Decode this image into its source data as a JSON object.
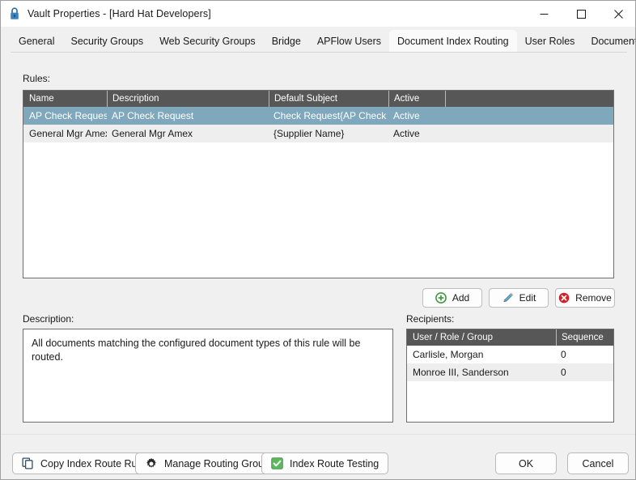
{
  "window": {
    "title": "Vault Properties - [Hard Hat Developers]",
    "lock_icon": "lock-icon",
    "controls": {
      "minimize": "minimize-icon",
      "maximize": "maximize-icon",
      "close": "close-icon"
    }
  },
  "tabs": [
    {
      "label": "General",
      "active": false
    },
    {
      "label": "Security Groups",
      "active": false
    },
    {
      "label": "Web Security Groups",
      "active": false
    },
    {
      "label": "Bridge",
      "active": false
    },
    {
      "label": "APFlow Users",
      "active": false
    },
    {
      "label": "Document Index Routing",
      "active": true
    },
    {
      "label": "User Roles",
      "active": false
    },
    {
      "label": "Document Publishing",
      "active": false
    }
  ],
  "rules": {
    "label": "Rules:",
    "columns": [
      "Name",
      "Description",
      "Default Subject",
      "Active",
      ""
    ],
    "rows": [
      {
        "name": "AP Check Request",
        "description": "AP Check Request",
        "default_subject": "Check Request{AP Check ...",
        "active": "Active",
        "extra": "",
        "selected": true
      },
      {
        "name": "General Mgr Amex",
        "description": "General Mgr Amex",
        "default_subject": "{Supplier Name}",
        "active": "Active",
        "extra": "",
        "selected": false
      }
    ]
  },
  "rule_actions": {
    "add": {
      "label": "Add",
      "icon": "plus-circle-icon",
      "color": "#3f9a3f"
    },
    "edit": {
      "label": "Edit",
      "icon": "pencil-icon",
      "color": "#4a90c4"
    },
    "remove": {
      "label": "Remove",
      "icon": "x-circle-icon",
      "color": "#d32028"
    }
  },
  "description": {
    "label": "Description:",
    "text": "All documents matching the configured document types of this rule will be routed."
  },
  "recipients": {
    "label": "Recipients:",
    "columns": [
      "User / Role / Group",
      "Sequence"
    ],
    "rows": [
      {
        "user": "Carlisle, Morgan",
        "sequence": "0"
      },
      {
        "user": "Monroe III, Sanderson",
        "sequence": "0"
      }
    ]
  },
  "footer": {
    "copy_rule": {
      "label": "Copy Index Route Rule",
      "icon": "copy-icon"
    },
    "manage_groups": {
      "label": "Manage Routing Groups",
      "icon": "gear-icon"
    },
    "index_route_testing": {
      "label": "Index Route Testing",
      "icon": "checkbox-checked-icon"
    },
    "ok": "OK",
    "cancel": "Cancel"
  },
  "colors": {
    "selection": "#7fa8bd",
    "header_bar": "#575757",
    "dialog_bg": "#f0f0f0",
    "accent_green": "#5cb85c",
    "accent_red": "#d32028",
    "accent_blue": "#4a90c4"
  }
}
